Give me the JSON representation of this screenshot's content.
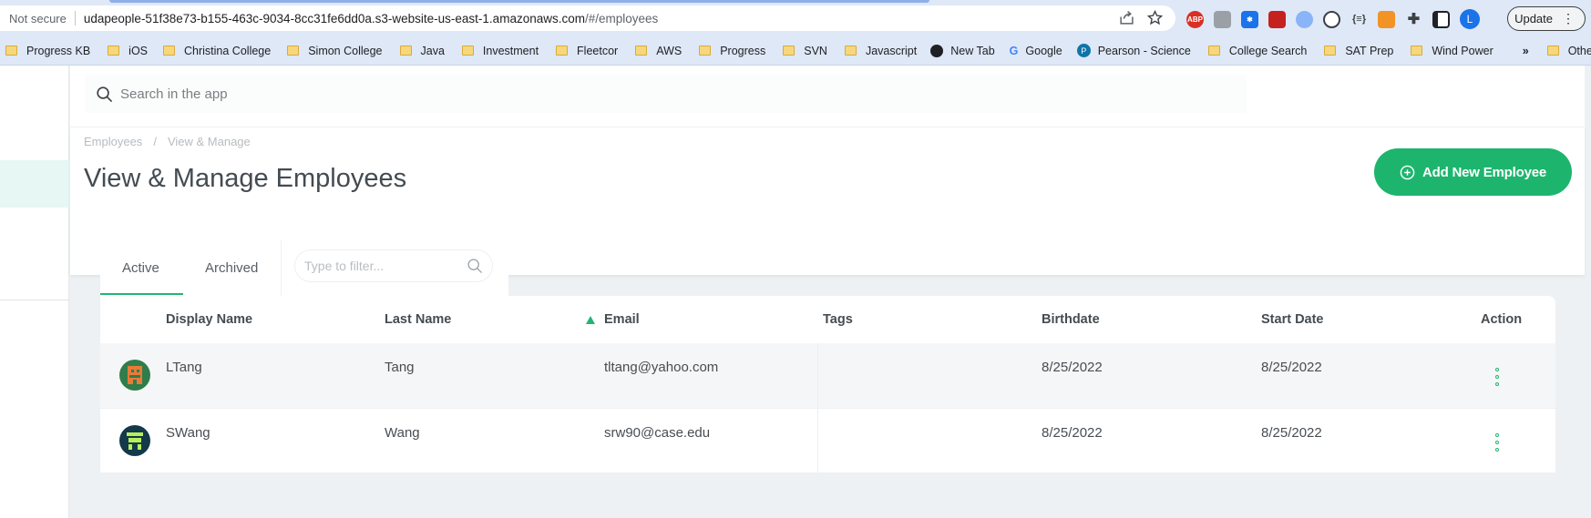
{
  "browser": {
    "not_secure": "Not secure",
    "url_host": "udapeople-51f38e73-b155-463c-9034-8cc31fe6dd0a.s3-website-us-east-1.amazonaws.com",
    "url_path": "/#/employees",
    "update_label": "Update",
    "profile_initial": "L",
    "bookmarks": [
      "Progress KB",
      "iOS",
      "Christina College",
      "Simon College",
      "Java",
      "Investment",
      "Fleetcor",
      "AWS",
      "Progress",
      "SVN",
      "Javascript",
      "New Tab",
      "Google",
      "Pearson - Science",
      "College Search",
      "SAT Prep",
      "Wind Power"
    ],
    "overflow": "»",
    "other_bookmarks": "Other bookmarks"
  },
  "app": {
    "search_placeholder": "Search in the app",
    "breadcrumb": [
      "Employees",
      "View & Manage"
    ],
    "title": "View & Manage Employees",
    "add_button": "Add New Employee",
    "accent_color": "#1db56d"
  },
  "table": {
    "tabs": [
      "Active",
      "Archived"
    ],
    "active_tab": "Active",
    "filter_placeholder": "Type to filter...",
    "columns": [
      "Display Name",
      "Last Name",
      "Email",
      "Tags",
      "Birthdate",
      "Start Date",
      "Action"
    ],
    "sorted_column": "Email",
    "rows": [
      {
        "display_name": "LTang",
        "last_name": "Tang",
        "email": "tltang@yahoo.com",
        "tags": "",
        "birthdate": "8/25/2022",
        "start_date": "8/25/2022"
      },
      {
        "display_name": "SWang",
        "last_name": "Wang",
        "email": "srw90@case.edu",
        "tags": "",
        "birthdate": "8/25/2022",
        "start_date": "8/25/2022"
      }
    ]
  }
}
